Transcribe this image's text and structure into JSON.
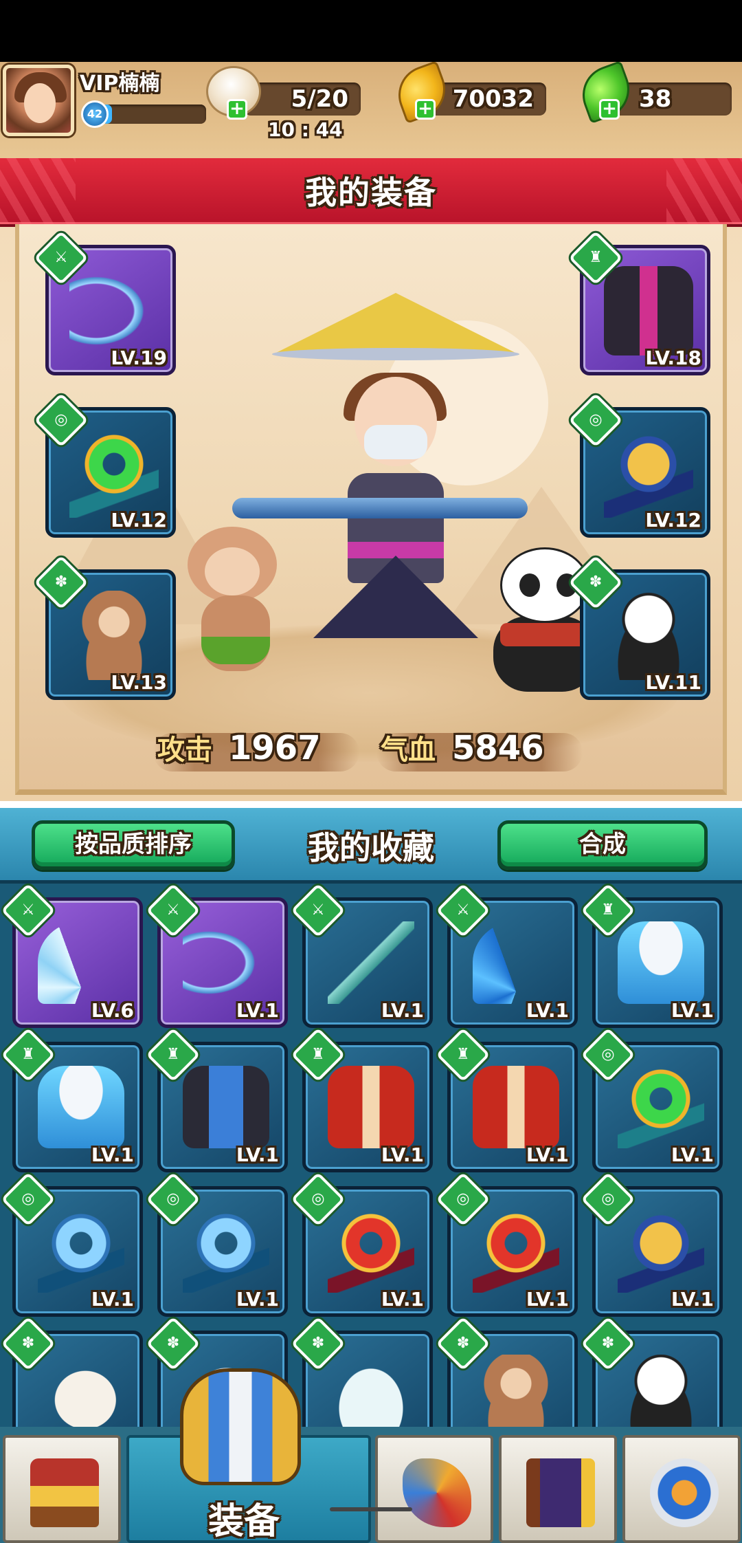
{
  "player": {
    "name": "VIP楠楠",
    "level": "42",
    "exp_fraction": 0.1
  },
  "resources": {
    "stamina": {
      "icon": "steamed-bun-icon",
      "value": "5/20",
      "timer": "10 : 44"
    },
    "gold": {
      "icon": "gold-leaf-icon",
      "value": "70032"
    },
    "jade": {
      "icon": "green-leaf-icon",
      "value": "38"
    }
  },
  "equipment": {
    "title": "我的装备",
    "slots": [
      {
        "type": "weapon",
        "item": "bow",
        "level": "LV.19"
      },
      {
        "type": "armor",
        "item": "dark-robe",
        "level": "LV.18"
      },
      {
        "type": "accessory",
        "item": "green-jade",
        "level": "LV.12"
      },
      {
        "type": "accessory",
        "item": "gold-jade",
        "level": "LV.12"
      },
      {
        "type": "pet",
        "item": "monkey",
        "level": "LV.13"
      },
      {
        "type": "pet",
        "item": "panda",
        "level": "LV.11"
      }
    ],
    "stats": {
      "attack_label": "攻击",
      "attack_value": "1967",
      "hp_label": "气血",
      "hp_value": "5846"
    }
  },
  "collection": {
    "title": "我的收藏",
    "sort_button": "按品质排序",
    "combine_button": "合成",
    "items": [
      {
        "art": "fan",
        "quality": "purple",
        "type": "weapon",
        "level": "LV.6"
      },
      {
        "art": "bow",
        "quality": "purple",
        "type": "weapon",
        "level": "LV.1"
      },
      {
        "art": "sword",
        "quality": "blue",
        "type": "weapon",
        "level": "LV.1"
      },
      {
        "art": "bluefan",
        "quality": "blue",
        "type": "weapon",
        "level": "LV.1"
      },
      {
        "art": "armor-snow",
        "quality": "blue",
        "type": "armor",
        "level": "LV.1"
      },
      {
        "art": "armor-snow",
        "quality": "blue",
        "type": "armor",
        "level": "LV.1"
      },
      {
        "art": "armor-blue",
        "quality": "blue",
        "type": "armor",
        "level": "LV.1"
      },
      {
        "art": "robe-red",
        "quality": "blue",
        "type": "armor",
        "level": "LV.1"
      },
      {
        "art": "robe-red",
        "quality": "blue",
        "type": "armor",
        "level": "LV.1"
      },
      {
        "art": "jade-green",
        "quality": "blue",
        "type": "accessory",
        "level": "LV.1"
      },
      {
        "art": "jade-blue",
        "quality": "blue",
        "type": "accessory",
        "level": "LV.1"
      },
      {
        "art": "jade-blue",
        "quality": "blue",
        "type": "accessory",
        "level": "LV.1"
      },
      {
        "art": "jade-red",
        "quality": "blue",
        "type": "accessory",
        "level": "LV.1"
      },
      {
        "art": "jade-red",
        "quality": "blue",
        "type": "accessory",
        "level": "LV.1"
      },
      {
        "art": "jade-gold",
        "quality": "blue",
        "type": "accessory",
        "level": "LV.1"
      },
      {
        "art": "bird",
        "quality": "blue",
        "type": "pet",
        "level": ""
      },
      {
        "art": "shark",
        "quality": "blue",
        "type": "pet",
        "level": ""
      },
      {
        "art": "ferret",
        "quality": "blue",
        "type": "pet",
        "level": ""
      },
      {
        "art": "monkey",
        "quality": "blue",
        "type": "pet",
        "level": ""
      },
      {
        "art": "panda",
        "quality": "blue",
        "type": "pet",
        "level": ""
      }
    ]
  },
  "nav": {
    "items": [
      {
        "name": "shop",
        "icon": "treasure-shop-icon",
        "label": ""
      },
      {
        "name": "equipment",
        "icon": "armor-icon",
        "label": "装备",
        "active": true
      },
      {
        "name": "weapon",
        "icon": "weapon-icon",
        "label": ""
      },
      {
        "name": "book",
        "icon": "book-icon",
        "label": ""
      },
      {
        "name": "settings",
        "icon": "gear-icon",
        "label": ""
      }
    ]
  },
  "colors": {
    "banner_red": "#c81a30",
    "button_green": "#1fb864",
    "panel_blue": "#1a5a77"
  }
}
